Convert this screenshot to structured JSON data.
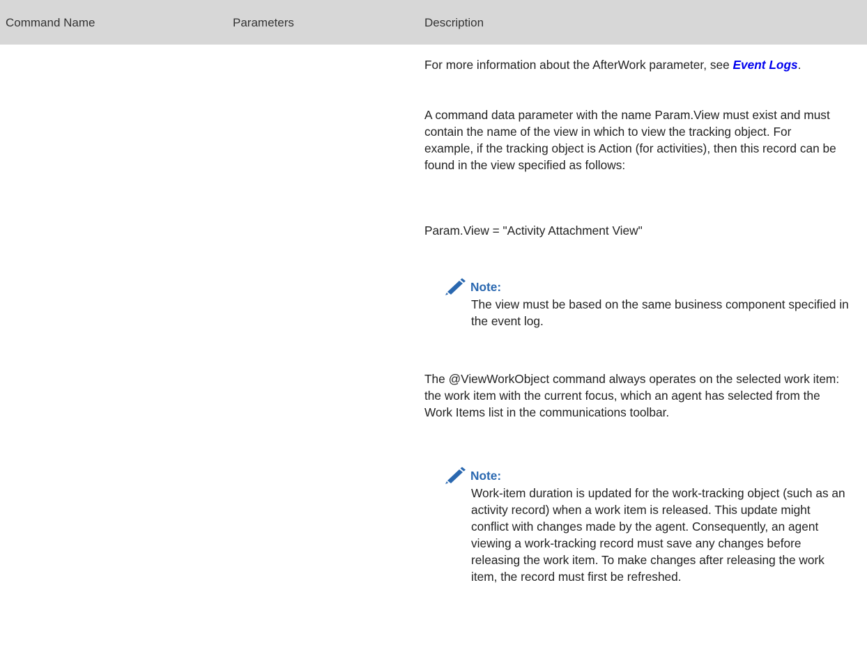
{
  "table": {
    "headers": {
      "command": "Command Name",
      "parameters": "Parameters",
      "description": "Description"
    }
  },
  "description": {
    "p1_before_link": "For more information about the AfterWork parameter, see ",
    "p1_link": "Event Logs",
    "p1_after_link": ".",
    "p2": "A command data parameter with the name Param.View must exist and must contain the name of the view in which to view the tracking object. For example, if the tracking object is Action (for activities), then this record can be found in the view specified as follows:",
    "p3": "Param.View = \"Activity Attachment View\"",
    "note1": {
      "label": "Note:",
      "text": "The view must be based on the same business component specified in the event log."
    },
    "p4": "The @ViewWorkObject command always operates on the selected work item: the work item with the current focus, which an agent has selected from the Work Items list in the communications toolbar.",
    "note2": {
      "label": "Note:",
      "text": "Work-item duration is updated for the work-tracking object (such as an activity record) when a work item is released. This update might conflict with changes made by the agent. Consequently, an agent viewing a work-tracking record must save any changes before releasing the work item. To make changes after releasing the work item, the record must first be refreshed."
    }
  },
  "colors": {
    "header_bg": "#d7d7d7",
    "link": "#0000ee",
    "note_accent": "#2a68b0"
  },
  "icons": {
    "note_icon": "pencil-icon"
  }
}
